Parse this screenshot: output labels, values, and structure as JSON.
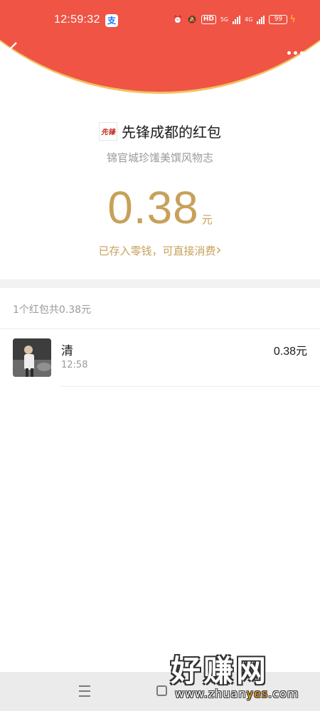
{
  "status_bar": {
    "time": "12:59:32",
    "app_icon": "alipay-icon",
    "alipay_glyph": "支",
    "hd": "HD",
    "net1": "5G",
    "net2": "4G",
    "battery": "99"
  },
  "header": {
    "back_icon": "back-arrow-icon",
    "more_icon": "more-dots-icon",
    "accent_color": "#f05444",
    "border_color": "#f2c25f"
  },
  "sender": {
    "logo_text": "先锋",
    "name": "先锋成都的红包",
    "subtitle": "锦官城珍馐美馔风物志"
  },
  "amount": {
    "value": "0.38",
    "unit": "元",
    "color": "#c7a15a",
    "saved_text": "已存入零钱，可直接消费",
    "saved_arrow": "›"
  },
  "summary": "1个红包共0.38元",
  "records": [
    {
      "name": "清",
      "time": "12:58",
      "amount": "0.38元"
    }
  ],
  "watermark": {
    "big": "好赚网",
    "url_pre": "www.zhuan",
    "url_mid": "yes",
    "url_post": ".com"
  },
  "navbar": {
    "menu_icon": "menu-icon",
    "home_icon": "home-square-icon"
  }
}
